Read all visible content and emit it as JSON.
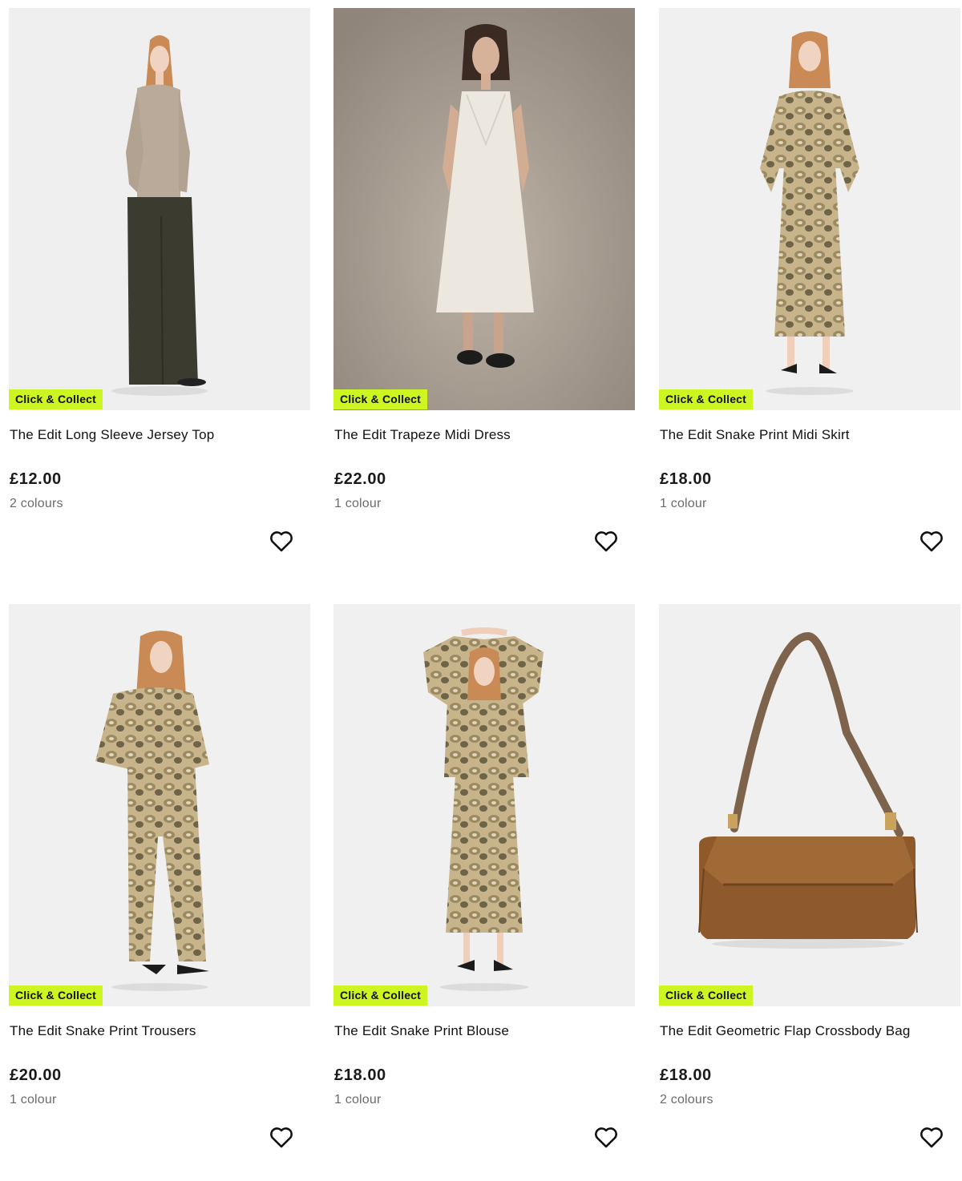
{
  "products": [
    {
      "badge": "Click & Collect",
      "title": "The Edit Long Sleeve Jersey Top",
      "price": "£12.00",
      "colours": "2 colours",
      "image_icon": "model-photo-jersey-top",
      "bg": "#efefef"
    },
    {
      "badge": "Click & Collect",
      "title": "The Edit Trapeze Midi Dress",
      "price": "£22.00",
      "colours": "1 colour",
      "image_icon": "model-photo-midi-dress",
      "bg": "#a49a8e"
    },
    {
      "badge": "Click & Collect",
      "title": "The Edit Snake Print Midi Skirt",
      "price": "£18.00",
      "colours": "1 colour",
      "image_icon": "model-photo-snake-skirt",
      "bg": "#f0f0f0"
    },
    {
      "badge": "Click & Collect",
      "title": "The Edit Snake Print Trousers",
      "price": "£20.00",
      "colours": "1 colour",
      "image_icon": "model-photo-snake-trousers",
      "bg": "#f0f0f0"
    },
    {
      "badge": "Click & Collect",
      "title": "The Edit Snake Print Blouse",
      "price": "£18.00",
      "colours": "1 colour",
      "image_icon": "model-photo-snake-blouse",
      "bg": "#f0f0f0"
    },
    {
      "badge": "Click & Collect",
      "title": "The Edit Geometric Flap Crossbody Bag",
      "price": "£18.00",
      "colours": "2 colours",
      "image_icon": "product-photo-crossbody-bag",
      "bg": "#f0f0f0"
    }
  ],
  "colors": {
    "badge_bg": "#cdf521",
    "text": "#111111",
    "muted": "#6b6b6b"
  },
  "icons": {
    "wishlist": "heart-outline-icon"
  }
}
